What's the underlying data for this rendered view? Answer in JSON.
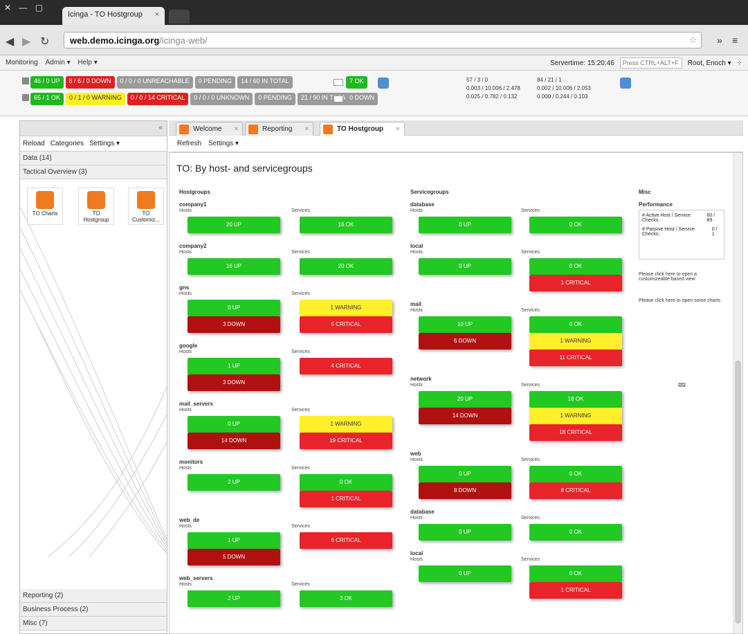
{
  "browser": {
    "tab_title": "Icinga - TO Hostgroup",
    "url_host": "web.demo.icinga.org",
    "url_path": "/icinga-web/"
  },
  "menu": {
    "items": [
      "Monitoring",
      "Admin ▾",
      "Help ▾"
    ],
    "servertime": "Servertime: 15:20:46",
    "search_placeholder": "Press CTRL+ALT+F",
    "user": "Root, Enoch ▾"
  },
  "status": {
    "host_pills": [
      {
        "label": "46 / 0 UP",
        "color": "green"
      },
      {
        "label": "8 / 6 / 0 DOWN",
        "color": "red"
      },
      {
        "label": "0 / 0 / 0 UNREACHABLE",
        "color": "gray"
      },
      {
        "label": "0 PENDING",
        "color": "gray"
      },
      {
        "label": "14 / 60 IN TOTAL",
        "color": "gray"
      }
    ],
    "service_pills": [
      {
        "label": "65 / 1 OK",
        "color": "green"
      },
      {
        "label": "0 / 1 / 0 WARNING",
        "color": "yellow"
      },
      {
        "label": "0 / 0 / 14 CRITICAL",
        "color": "red"
      },
      {
        "label": "0 / 0 / 0 UNKNOWN",
        "color": "gray"
      },
      {
        "label": "0 PENDING",
        "color": "gray"
      },
      {
        "label": "21 / 90 IN TOTAL",
        "color": "gray"
      }
    ],
    "mini_ok": "7 OK",
    "mini_down": "0 DOWN",
    "stats_left": [
      "57 / 3 / 0",
      "0.003 / 10.006 / 2.478",
      "0.025 / 0.782 / 0.132"
    ],
    "stats_right": [
      "84 / 21 / 1",
      "0.002 / 10.006 / 2.053",
      "0.000 / 0.244 / 0.103"
    ]
  },
  "left": {
    "tools": [
      "Reload",
      "Categories",
      "Settings ▾"
    ],
    "sections_top": [
      "Data (14)",
      "Tactical Overview (3)"
    ],
    "tiles": [
      "TO Charts",
      "TO Hostgroup",
      "TO Customiz..."
    ],
    "sections_bottom": [
      "Reporting (2)",
      "Business Process (2)",
      "Misc (7)"
    ]
  },
  "tabs": [
    "Welcome",
    "Reporting",
    "TO Hostgroup"
  ],
  "main_tools": [
    "Refresh",
    "Settings ▾"
  ],
  "page_title": "TO: By host- and servicegroups",
  "headers": {
    "hostgroups": "Hostgroups",
    "servicegroups": "Servicegroups",
    "misc": "Misc"
  },
  "labels": {
    "hosts": "Hosts",
    "services": "Services"
  },
  "hostgroups": [
    {
      "name": "company1",
      "hosts": [
        {
          "t": "20 UP",
          "c": "green"
        }
      ],
      "services": [
        {
          "t": "16 OK",
          "c": "green"
        }
      ]
    },
    {
      "name": "company2",
      "hosts": [
        {
          "t": "16 UP",
          "c": "green"
        }
      ],
      "services": [
        {
          "t": "20 OK",
          "c": "green"
        }
      ]
    },
    {
      "name": "gns",
      "hosts": [
        {
          "t": "0 UP",
          "c": "green"
        },
        {
          "t": "3 DOWN",
          "c": "dkred"
        }
      ],
      "services": [
        {
          "t": "1 WARNING",
          "c": "yellow"
        },
        {
          "t": "5 CRITICAL",
          "c": "red"
        }
      ]
    },
    {
      "name": "google",
      "hosts": [
        {
          "t": "1 UP",
          "c": "green"
        },
        {
          "t": "3 DOWN",
          "c": "dkred"
        }
      ],
      "services": [
        {
          "t": "4 CRITICAL",
          "c": "red"
        }
      ]
    },
    {
      "name": "mail_servers",
      "hosts": [
        {
          "t": "0 UP",
          "c": "green"
        },
        {
          "t": "14 DOWN",
          "c": "dkred"
        }
      ],
      "services": [
        {
          "t": "1 WARNING",
          "c": "yellow"
        },
        {
          "t": "19 CRITICAL",
          "c": "red"
        }
      ]
    },
    {
      "name": "monitors",
      "hosts": [
        {
          "t": "2 UP",
          "c": "green"
        }
      ],
      "services": [
        {
          "t": "0 OK",
          "c": "green"
        },
        {
          "t": "1 CRITICAL",
          "c": "red"
        }
      ]
    },
    {
      "name": "web_de",
      "hosts": [
        {
          "t": "1 UP",
          "c": "green"
        },
        {
          "t": "5 DOWN",
          "c": "dkred"
        }
      ],
      "services": [
        {
          "t": "6 CRITICAL",
          "c": "red"
        }
      ]
    },
    {
      "name": "web_servers",
      "hosts": [
        {
          "t": "2 UP",
          "c": "green"
        }
      ],
      "services": [
        {
          "t": "3 OK",
          "c": "green"
        }
      ]
    }
  ],
  "servicegroups": [
    {
      "name": "database",
      "hosts": [
        {
          "t": "0 UP",
          "c": "green"
        }
      ],
      "services": [
        {
          "t": "0 OK",
          "c": "green"
        }
      ]
    },
    {
      "name": "local",
      "hosts": [
        {
          "t": "0 UP",
          "c": "green"
        }
      ],
      "services": [
        {
          "t": "0 OK",
          "c": "green"
        },
        {
          "t": "1 CRITICAL",
          "c": "red"
        }
      ]
    },
    {
      "name": "mail",
      "hosts": [
        {
          "t": "10 UP",
          "c": "green"
        },
        {
          "t": "6 DOWN",
          "c": "dkred"
        }
      ],
      "services": [
        {
          "t": "0 OK",
          "c": "green"
        },
        {
          "t": "1 WARNING",
          "c": "yellow"
        },
        {
          "t": "11 CRITICAL",
          "c": "red"
        }
      ]
    },
    {
      "name": "network",
      "hosts": [
        {
          "t": "20 UP",
          "c": "green"
        },
        {
          "t": "14 DOWN",
          "c": "dkred"
        }
      ],
      "services": [
        {
          "t": "18 OK",
          "c": "green"
        },
        {
          "t": "1 WARNING",
          "c": "yellow"
        },
        {
          "t": "18 CRITICAL",
          "c": "red"
        }
      ]
    },
    {
      "name": "web",
      "hosts": [
        {
          "t": "0 UP",
          "c": "green"
        },
        {
          "t": "8 DOWN",
          "c": "dkred"
        }
      ],
      "services": [
        {
          "t": "0 OK",
          "c": "green"
        },
        {
          "t": "8 CRITICAL",
          "c": "red"
        }
      ]
    },
    {
      "name": "database",
      "hosts": [
        {
          "t": "0 UP",
          "c": "green"
        }
      ],
      "services": [
        {
          "t": "0 OK",
          "c": "green"
        }
      ]
    },
    {
      "name": "local",
      "hosts": [
        {
          "t": "0 UP",
          "c": "green"
        }
      ],
      "services": [
        {
          "t": "0 OK",
          "c": "green"
        },
        {
          "t": "1 CRITICAL",
          "c": "red"
        }
      ]
    }
  ],
  "misc": {
    "performance_label": "Performance",
    "rows": [
      {
        "label": "# Active Host / Service Checks:",
        "value": "60 / 89"
      },
      {
        "label": "# Passive Host / Service Checks:",
        "value": "0 / 1"
      }
    ],
    "link1": "Please click here to open a customizeable based view",
    "link2": "Please click here to open some charts"
  },
  "colors": {
    "green": "#22c922",
    "red": "#e8232a",
    "dkred": "#b01010",
    "yellow": "#fff02a"
  }
}
